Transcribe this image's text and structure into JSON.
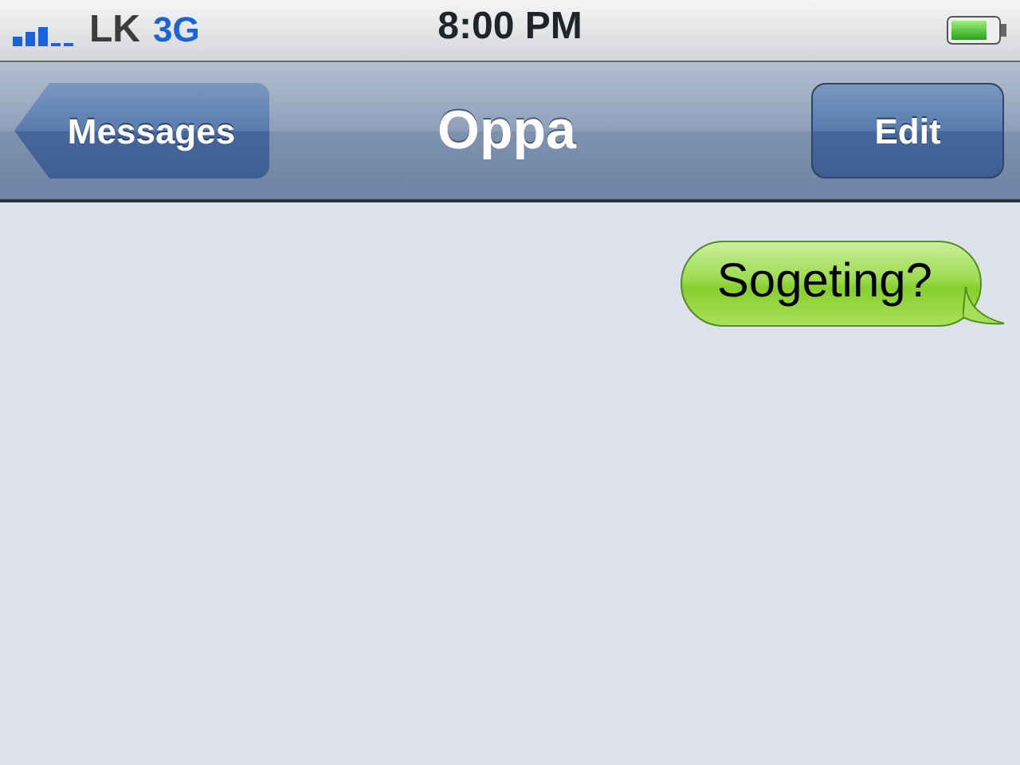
{
  "status_bar": {
    "carrier": "LK",
    "network": "3G",
    "time": "8:00 PM"
  },
  "nav_bar": {
    "back_button": "Messages",
    "title": "Oppa",
    "edit_button": "Edit"
  },
  "messages": [
    {
      "text": "Sogeting?",
      "kind": "sent"
    }
  ]
}
